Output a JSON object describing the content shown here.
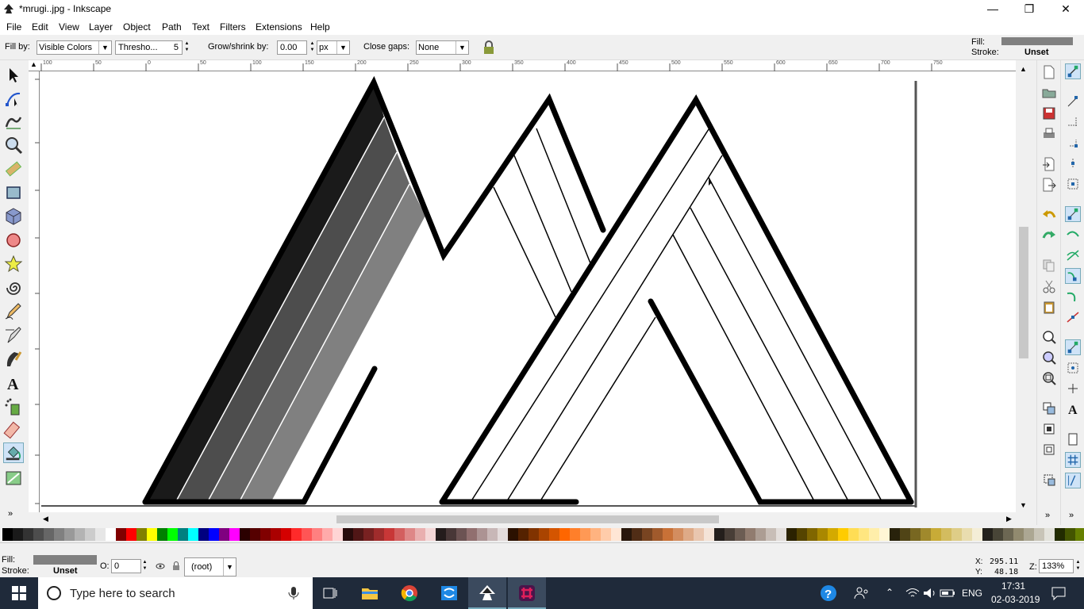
{
  "window": {
    "title": "*mrugi..jpg - Inkscape",
    "minimize": "—",
    "maximize": "❐",
    "close": "✕"
  },
  "menu": [
    "File",
    "Edit",
    "View",
    "Layer",
    "Object",
    "Path",
    "Text",
    "Filters",
    "Extensions",
    "Help"
  ],
  "tool_controls": {
    "fill_by_label": "Fill by:",
    "fill_by_value": "Visible Colors",
    "threshold_value": "Thresho...",
    "threshold_num": "5",
    "grow_label": "Grow/shrink by:",
    "grow_value": "0.00",
    "unit_value": "px",
    "close_gaps_label": "Close gaps:",
    "close_gaps_value": "None"
  },
  "style_indicator": {
    "fill_label": "Fill:",
    "stroke_label": "Stroke:",
    "stroke_value": "Unset",
    "fill_color": "#808080"
  },
  "ruler_ticks": [
    "100",
    "50",
    "0",
    "50",
    "100",
    "150",
    "200",
    "250",
    "300",
    "350",
    "400",
    "450",
    "500",
    "550",
    "600",
    "650",
    "700",
    "750"
  ],
  "status": {
    "fill_label": "Fill:",
    "stroke_label": "Stroke:",
    "stroke_value": "Unset",
    "opacity_label": "O:",
    "opacity_value": "0",
    "layer_value": "(root)",
    "x_label": "X:",
    "x_value": "295.11",
    "y_label": "Y:",
    "y_value": "48.18",
    "zoom_label": "Z:",
    "zoom_value": "133%"
  },
  "taskbar": {
    "search_placeholder": "Type here to search",
    "time": "17:31",
    "date": "02-03-2019",
    "lang": "ENG"
  },
  "palette": [
    "#000000",
    "#1a1a1a",
    "#333333",
    "#4d4d4d",
    "#666666",
    "#808080",
    "#999999",
    "#b3b3b3",
    "#cccccc",
    "#e6e6e6",
    "#ffffff",
    "#800000",
    "#ff0000",
    "#808000",
    "#ffff00",
    "#008000",
    "#00ff00",
    "#008080",
    "#00ffff",
    "#000080",
    "#0000ff",
    "#800080",
    "#ff00ff",
    "#2b0000",
    "#550000",
    "#800000",
    "#aa0000",
    "#d40000",
    "#ff2a2a",
    "#ff5555",
    "#ff8080",
    "#ffaaaa",
    "#ffd5d5",
    "#280b0b",
    "#501616",
    "#782121",
    "#a02c2c",
    "#c83737",
    "#d35f5f",
    "#de8787",
    "#e9afaf",
    "#f4d7d7",
    "#241c1c",
    "#483737",
    "#6c5353",
    "#916f6f",
    "#ac9393",
    "#c8b7b7",
    "#e3dbdb",
    "#2b1100",
    "#552200",
    "#803300",
    "#aa4400",
    "#d45500",
    "#ff6600",
    "#ff7f2a",
    "#ff9955",
    "#ffb380",
    "#ffccaa",
    "#ffe6d5",
    "#28170b",
    "#502d16",
    "#784421",
    "#a05a2c",
    "#c87137",
    "#d38d5f",
    "#deaa87",
    "#e9c6af",
    "#f4e3d7",
    "#241f1c",
    "#483e37",
    "#6c5d53",
    "#917c6f",
    "#ac9d93",
    "#c8beb7",
    "#e3dedb",
    "#2b2200",
    "#554400",
    "#806600",
    "#aa8800",
    "#d4aa00",
    "#ffcc00",
    "#ffdd55",
    "#ffe680",
    "#ffeeaa",
    "#fff6d5",
    "#28220b",
    "#504416",
    "#786721",
    "#a0892c",
    "#c8ab37",
    "#d3bc5f",
    "#decd87",
    "#e9ddaf",
    "#f4eed7",
    "#24221c",
    "#484537",
    "#6c6753",
    "#918a6f",
    "#aca793",
    "#c8c4b7",
    "#e3e2db",
    "#222b00",
    "#445500",
    "#668000"
  ]
}
